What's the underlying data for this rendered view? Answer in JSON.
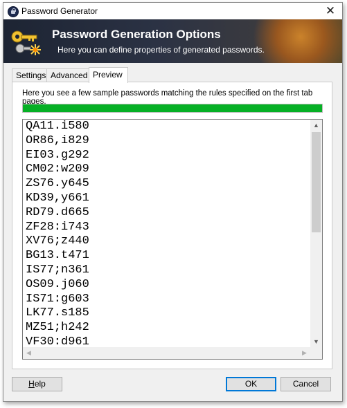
{
  "window": {
    "title": "Password Generator",
    "close_glyph": "✕"
  },
  "banner": {
    "title": "Password Generation Options",
    "subtitle": "Here you can define properties of generated passwords."
  },
  "tabs": [
    {
      "label": "Settings",
      "active": false
    },
    {
      "label": "Advanced",
      "active": false
    },
    {
      "label": "Preview",
      "active": true
    }
  ],
  "preview": {
    "description": "Here you see a few sample passwords matching the rules specified on the first tab pages.",
    "strength_fraction": 1.0,
    "passwords": [
      "QA11.i580",
      "OR86,i829",
      "EI03.g292",
      "CM02:w209",
      "ZS76.y645",
      "KD39,y661",
      "RD79.d665",
      "ZF28:i743",
      "XV76;z440",
      "BG13.t471",
      "IS77;n361",
      "OS09.j060",
      "IS71:g603",
      "LK77.s185",
      "MZ51;h242",
      "VF30:d961"
    ]
  },
  "buttons": {
    "help_rest": "elp",
    "ok": "OK",
    "cancel": "Cancel"
  },
  "colors": {
    "strength_fill": "#06b025",
    "default_button_border": "#0078d7"
  }
}
